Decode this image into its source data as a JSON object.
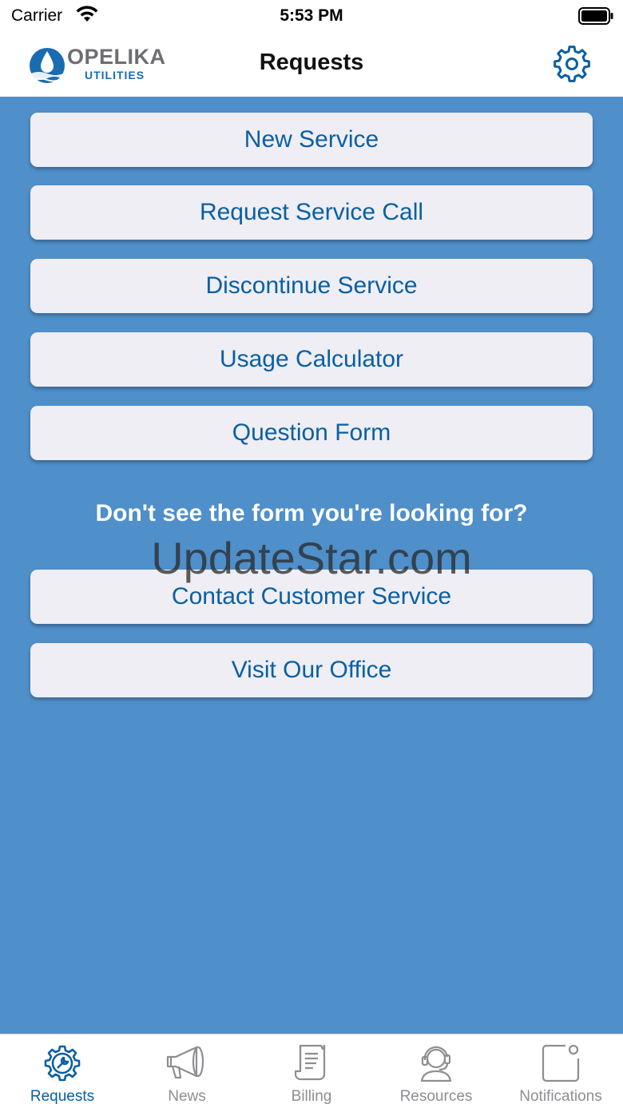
{
  "status_bar": {
    "carrier": "Carrier",
    "time": "5:53 PM"
  },
  "header": {
    "logo_title": "OPELIKA",
    "logo_subtitle": "UTILITIES",
    "title": "Requests",
    "settings_icon": "gear-icon"
  },
  "menu": {
    "buttons": [
      {
        "label": "New Service"
      },
      {
        "label": "Request Service Call"
      },
      {
        "label": "Discontinue Service"
      },
      {
        "label": "Usage Calculator"
      },
      {
        "label": "Question Form"
      }
    ],
    "prompt": "Don't see the form you're looking for?",
    "contact_buttons": [
      {
        "label": "Contact Customer Service"
      },
      {
        "label": "Visit Our Office"
      }
    ]
  },
  "watermark": "UpdateStar.com",
  "tab_bar": {
    "active": "Requests",
    "tabs": [
      {
        "label": "Requests",
        "icon": "gear-wrench-icon"
      },
      {
        "label": "News",
        "icon": "megaphone-icon"
      },
      {
        "label": "Billing",
        "icon": "receipt-icon"
      },
      {
        "label": "Resources",
        "icon": "headset-icon"
      },
      {
        "label": "Notifications",
        "icon": "notification-icon"
      }
    ]
  },
  "colors": {
    "background": "#4f8fca",
    "button": "#eeeef4",
    "button_text": "#0a5fa4",
    "tab_active": "#0a5fa4",
    "tab_inactive": "#8e8e93"
  }
}
